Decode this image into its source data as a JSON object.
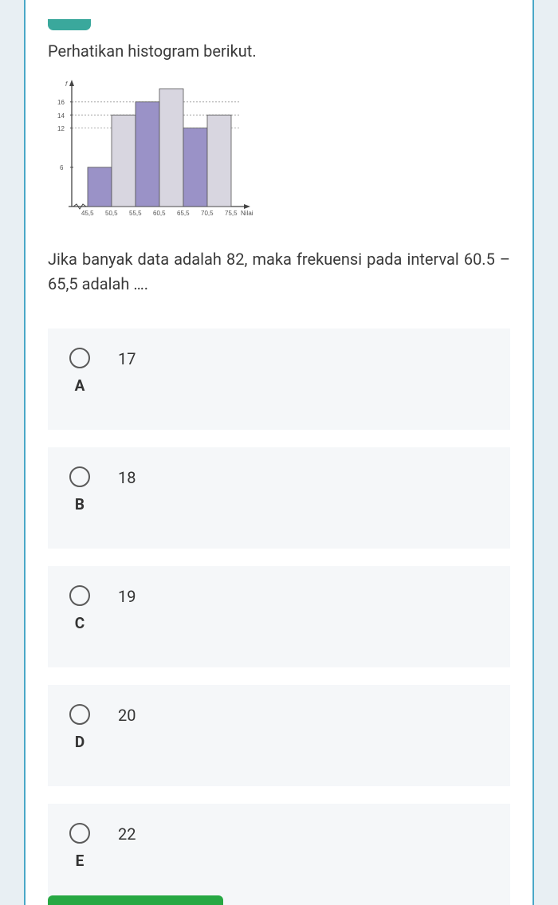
{
  "intro": "Perhatikan histogram berikut.",
  "question": "Jika banyak data adalah 82, maka frekuensi pada interval 60.5 – 65,5 adalah ….",
  "options": [
    {
      "letter": "A",
      "value": "17"
    },
    {
      "letter": "B",
      "value": "18"
    },
    {
      "letter": "C",
      "value": "19"
    },
    {
      "letter": "D",
      "value": "20"
    },
    {
      "letter": "E",
      "value": "22"
    }
  ],
  "chart_data": {
    "type": "bar",
    "title": "",
    "xlabel": "Nilai",
    "ylabel": "f",
    "ylim": [
      0,
      18
    ],
    "y_ticks": [
      6,
      12,
      14,
      16
    ],
    "x_boundaries": [
      "45,5",
      "50,5",
      "55,5",
      "60,5",
      "65,5",
      "70,5",
      "75,5"
    ],
    "bars": [
      {
        "interval": "45,5–50,5",
        "value": 6
      },
      {
        "interval": "50,5–55,5",
        "value": 14
      },
      {
        "interval": "55,5–60,5",
        "value": 16
      },
      {
        "interval": "60,5–65,5",
        "value": null,
        "note": "unknown; top above 16"
      },
      {
        "interval": "65,5–70,5",
        "value": 12
      },
      {
        "interval": "70,5–75,5",
        "value": 14
      }
    ]
  }
}
